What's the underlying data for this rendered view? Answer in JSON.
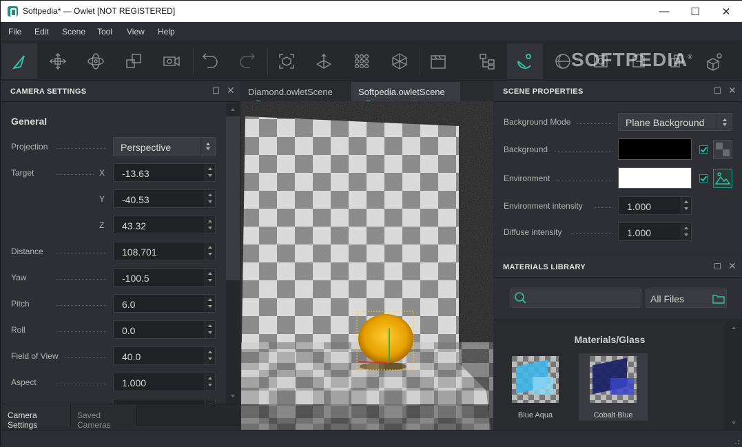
{
  "window": {
    "title": "Softpedia* — Owlet [NOT REGISTERED]",
    "minimize_glyph": "—",
    "maximize_glyph": "☐",
    "close_glyph": "✕"
  },
  "menu": [
    "File",
    "Edit",
    "Scene",
    "Tool",
    "View",
    "Help"
  ],
  "toolbar": {
    "icons": [
      "select-arrow-icon",
      "move-icon",
      "rotate-icon",
      "scale-icon",
      "camera-icon",
      "undo-icon",
      "redo-icon",
      "frame-selection-icon",
      "frame-all-icon",
      "grid-icon",
      "wireframe-icon",
      "clapperboard-icon",
      "hierarchy-icon",
      "scene-settings-icon",
      "material-sphere-icon",
      "render-icon",
      "environment-icon",
      "copy-icon",
      "geometry-icon"
    ],
    "watermark": "SOFTPEDIA",
    "watermark_mark": "®"
  },
  "camera_panel": {
    "title": "CAMERA SETTINGS",
    "section": "General",
    "projection_label": "Projection",
    "projection_value": "Perspective",
    "target_label": "Target",
    "target": [
      {
        "axis": "X",
        "value": "-13.63"
      },
      {
        "axis": "Y",
        "value": "-40.53"
      },
      {
        "axis": "Z",
        "value": "43.32"
      }
    ],
    "rows": [
      {
        "label": "Distance",
        "value": "108.701"
      },
      {
        "label": "Yaw",
        "value": "-100.5"
      },
      {
        "label": "Pitch",
        "value": "6.0"
      },
      {
        "label": "Roll",
        "value": "0.0"
      },
      {
        "label": "Field of View",
        "value": "40.0"
      },
      {
        "label": "Aspect",
        "value": "1.000"
      }
    ],
    "tabs": [
      "Camera Settings",
      "Saved Cameras"
    ]
  },
  "documents": {
    "tabs": [
      {
        "label": "Diamond.owletScene",
        "active": false
      },
      {
        "label": "Softpedia.owletScene",
        "active": true
      }
    ]
  },
  "scene_panel": {
    "title": "SCENE PROPERTIES",
    "background_mode_label": "Background Mode",
    "background_mode_value": "Plane Background",
    "background_label": "Background",
    "background_color": "#000000",
    "environment_label": "Environment",
    "environment_color": "#ffffff",
    "env_intensity_label": "Environment intensity",
    "env_intensity_value": "1.000",
    "diffuse_intensity_label": "Diffuse intensity",
    "diffuse_intensity_value": "1.000"
  },
  "materials_panel": {
    "title": "MATERIALS LIBRARY",
    "search_placeholder": "",
    "filter_value": "All Files",
    "category": "Materials/Glass",
    "items": [
      {
        "name": "Blue Aqua",
        "color": "#3fb6e8"
      },
      {
        "name": "Cobalt Blue",
        "color": "#2a2f8f"
      }
    ]
  },
  "colors": {
    "accent": "#1e9b84",
    "panel": "#2e2f34",
    "toolbar": "#27282c"
  }
}
